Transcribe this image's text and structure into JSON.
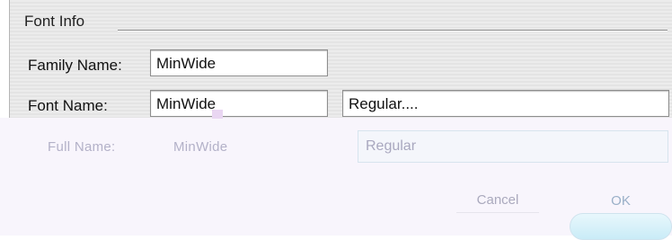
{
  "font_info": {
    "section_title": "Font Info",
    "family_name_label": "Family Name:",
    "family_name_value": "MinWide",
    "font_name_label": "Font Name:",
    "font_name_value": "MinWide",
    "style_value": "Regular...."
  },
  "overlay": {
    "full_name_label": "Full Name:",
    "full_name_value": "MinWide",
    "style_field_value": "Regular",
    "cancel_label": "Cancel",
    "ok_label": "OK"
  }
}
